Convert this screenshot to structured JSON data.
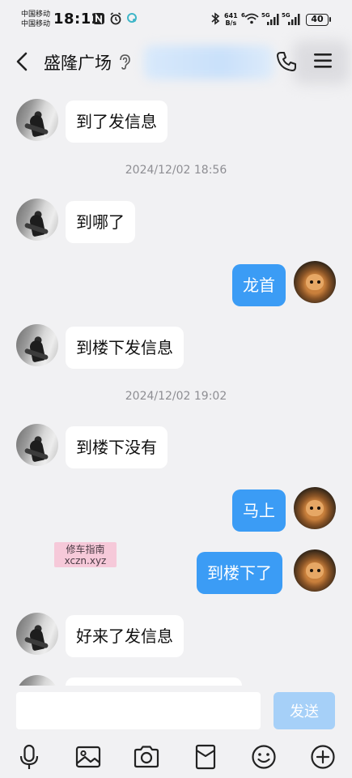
{
  "status_bar": {
    "carrier_1": "中国移动",
    "carrier_2": "中国移动",
    "time": "18:12",
    "net_speed_value": "641",
    "net_speed_unit": "B/s",
    "wifi_label": "6",
    "signal_1_label": "5G",
    "signal_2_label": "5G",
    "battery": "40"
  },
  "header": {
    "title": "盛隆广场"
  },
  "messages": [
    {
      "side": "in",
      "text": "到了发信息"
    },
    {
      "side": "time",
      "text": "2024/12/02 18:56"
    },
    {
      "side": "in",
      "text": "到哪了"
    },
    {
      "side": "out",
      "text": "龙首"
    },
    {
      "side": "in",
      "text": "到楼下发信息"
    },
    {
      "side": "time",
      "text": "2024/12/02 19:02"
    },
    {
      "side": "in",
      "text": "到楼下没有"
    },
    {
      "side": "out",
      "text": "马上"
    },
    {
      "side": "out",
      "text": "到楼下了"
    },
    {
      "side": "in",
      "text": "好来了发信息"
    }
  ],
  "watermark": {
    "line1": "修车指南",
    "line2": "xczn.xyz"
  },
  "composer": {
    "input_value": "",
    "send_label": "发送"
  },
  "colors": {
    "background": "#F1F1F3",
    "incoming_bubble": "#FFFFFF",
    "outgoing_bubble": "#3B9CF5",
    "send_disabled": "#A6D0F8"
  },
  "toolbar_icons": [
    "microphone-icon",
    "image-icon",
    "camera-icon",
    "red-packet-icon",
    "emoji-icon",
    "plus-icon"
  ]
}
